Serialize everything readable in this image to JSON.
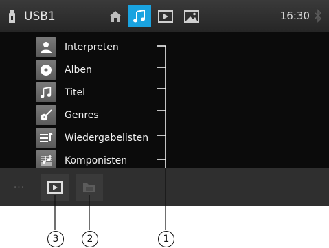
{
  "status_bar": {
    "source_label": "USB1",
    "time": "16:30",
    "tabs": [
      {
        "name": "home-icon",
        "active": false
      },
      {
        "name": "music-note-icon",
        "active": true
      },
      {
        "name": "play-icon",
        "active": false
      },
      {
        "name": "picture-icon",
        "active": false
      }
    ],
    "accent_color": "#1aa3e0"
  },
  "menu": {
    "items": [
      {
        "label": "Interpreten",
        "icon": "artist-icon"
      },
      {
        "label": "Alben",
        "icon": "album-disc-icon"
      },
      {
        "label": "Titel",
        "icon": "track-note-icon"
      },
      {
        "label": "Genres",
        "icon": "guitar-icon"
      },
      {
        "label": "Wiedergabelisten",
        "icon": "playlist-icon"
      },
      {
        "label": "Komponisten",
        "icon": "sheet-music-icon"
      }
    ]
  },
  "bottom_bar": {
    "more_label": "···",
    "buttons": [
      {
        "name": "now-playing-icon"
      },
      {
        "name": "folder-icon"
      }
    ]
  },
  "callouts": [
    "1",
    "2",
    "3"
  ]
}
